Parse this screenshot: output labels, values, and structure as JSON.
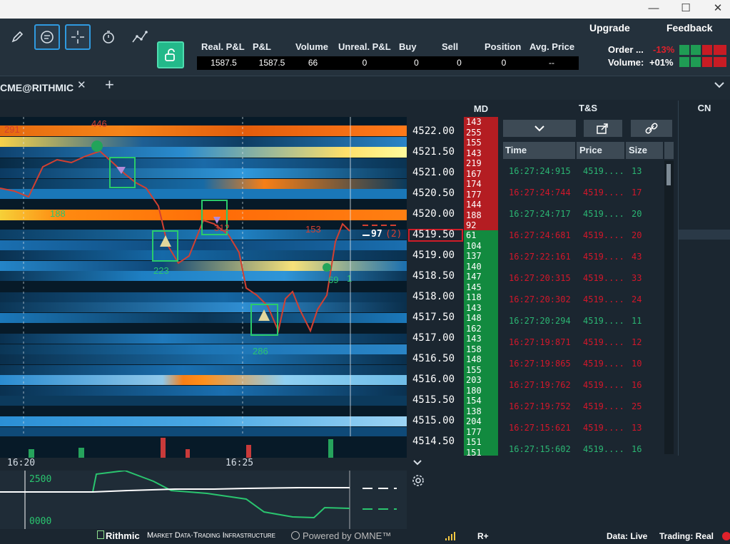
{
  "window": {
    "minimize_icon": "—",
    "maximize_icon": "☐",
    "close_icon": "✕"
  },
  "menu": {
    "upgrade": "Upgrade",
    "feedback": "Feedback"
  },
  "order_stats": {
    "order_label": "Order ...",
    "order_pct": "-13%",
    "volume_label": "Volume:",
    "volume_pct": "+01%"
  },
  "pnl": {
    "headers": [
      "Real. P&L",
      "P&L",
      "Volume",
      "Unreal. P&L",
      "Buy",
      "Sell",
      "Position",
      "Avg. Price"
    ],
    "values": [
      "1587.5",
      "1587.5",
      "66",
      "0",
      "0",
      "0",
      "0",
      "--"
    ]
  },
  "tab": {
    "label": "CME@RITHMIC",
    "close": "✕",
    "add": "+"
  },
  "chart": {
    "level_labels": [
      "291",
      "446",
      "188",
      "223",
      "312",
      "153",
      "69",
      "1",
      "286"
    ],
    "current_qty": "97",
    "current_paren": "(2)",
    "time_labels": [
      "16:20",
      "16:25"
    ],
    "osc_labels": [
      "2500",
      "0000"
    ]
  },
  "dom": {
    "md_header": "MD",
    "prices": [
      "4522.00",
      "4521.50",
      "4521.00",
      "4520.50",
      "4520.00",
      "4519.50",
      "4519.00",
      "4518.50",
      "4518.00",
      "4517.50",
      "4517.00",
      "4516.50",
      "4516.00",
      "4515.50",
      "4515.00",
      "4514.50"
    ],
    "ask_sizes": [
      "143",
      "255",
      "155",
      "143",
      "219",
      "167",
      "174",
      "177",
      "144",
      "188",
      "92"
    ],
    "bid_sizes": [
      "61",
      "104",
      "137",
      "140",
      "147",
      "145",
      "118",
      "143",
      "148",
      "162",
      "143",
      "158",
      "148",
      "155",
      "203",
      "180",
      "154",
      "138",
      "204",
      "177",
      "151",
      "151"
    ]
  },
  "ts": {
    "header": "T&S",
    "columns": [
      "Time",
      "Price",
      "Size"
    ],
    "rows": [
      {
        "time": "16:27:24:915",
        "price": "4519....",
        "size": "13",
        "side": "buy"
      },
      {
        "time": "16:27:24:744",
        "price": "4519....",
        "size": "17",
        "side": "sell"
      },
      {
        "time": "16:27:24:717",
        "price": "4519....",
        "size": "20",
        "side": "buy"
      },
      {
        "time": "16:27:24:681",
        "price": "4519....",
        "size": "20",
        "side": "sell"
      },
      {
        "time": "16:27:22:161",
        "price": "4519....",
        "size": "43",
        "side": "sell"
      },
      {
        "time": "16:27:20:315",
        "price": "4519....",
        "size": "33",
        "side": "sell"
      },
      {
        "time": "16:27:20:302",
        "price": "4519....",
        "size": "24",
        "side": "sell"
      },
      {
        "time": "16:27:20:294",
        "price": "4519....",
        "size": "11",
        "side": "buy"
      },
      {
        "time": "16:27:19:871",
        "price": "4519....",
        "size": "12",
        "side": "sell"
      },
      {
        "time": "16:27:19:865",
        "price": "4519....",
        "size": "10",
        "side": "sell"
      },
      {
        "time": "16:27:19:762",
        "price": "4519....",
        "size": "16",
        "side": "sell"
      },
      {
        "time": "16:27:19:752",
        "price": "4519....",
        "size": "25",
        "side": "sell"
      },
      {
        "time": "16:27:15:621",
        "price": "4519....",
        "size": "13",
        "side": "sell"
      },
      {
        "time": "16:27:15:602",
        "price": "4519....",
        "size": "16",
        "side": "buy"
      }
    ]
  },
  "cn": {
    "header": "CN"
  },
  "footer": {
    "rithmic": "Rithmic",
    "rithmic_sub": "Market Data·Trading Infrastructure",
    "powered": "Powered by OMNE™",
    "r_plus": "R+",
    "data_status": "Data: Live",
    "trading_status": "Trading: Real"
  }
}
